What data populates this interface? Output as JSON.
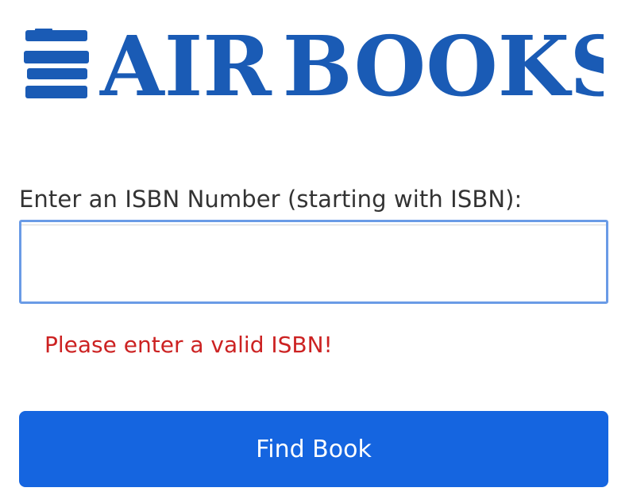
{
  "logo": {
    "text_first": "AIR",
    "text_second": "BOOKS",
    "brand_color": "#1a5bb5"
  },
  "form": {
    "label": "Enter an ISBN Number (starting with ISBN):",
    "input_value": "",
    "error_message": "Please enter a valid ISBN!",
    "error_color": "#cc2222",
    "input_focus_color": "#6a9be6"
  },
  "button": {
    "label": "Find Book",
    "color": "#1565e0"
  }
}
